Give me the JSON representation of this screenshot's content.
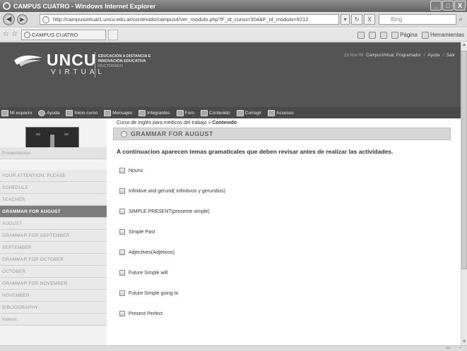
{
  "window": {
    "title": "CAMPUS CUATRO - Windows Internet Explorer",
    "minimize": "_",
    "maximize": "□",
    "close": "X"
  },
  "browser": {
    "back": "◀",
    "forward": "▶",
    "url": "http://campusvirtual1.uncu.edu.ar/contenido/campus4/ver_modulo.php?F_id_curso=304&F_id_modulo=9212",
    "dropdown": "▾",
    "refresh": "↻",
    "stop": "X",
    "search_placeholder": "Bing",
    "search_button": "⌕",
    "tab_title": "CAMPUS CUATRO",
    "cmd": {
      "page": "Página",
      "tools": "Herramientas"
    }
  },
  "site": {
    "logo_text": "UNCU",
    "logo_sub": "VIRTUAL",
    "edu_line1": "EDUCACIÓN A DISTANCIA E",
    "edu_line2": "INNOVACIÓN EDUCATIVA",
    "edu_line3": "RECTORADO",
    "user_date": "23 Nov 09",
    "user_name": "CampusVirtual, Programador",
    "sep": "/",
    "help": "Ayuda",
    "logout": "Salir"
  },
  "nav": {
    "items": [
      {
        "label": "Mi espacio"
      },
      {
        "label": "Ayuda"
      },
      {
        "label": "Inicio curso"
      },
      {
        "label": "Mensajes"
      },
      {
        "label": "Integrantes"
      },
      {
        "label": "Foro"
      },
      {
        "label": "Contenido"
      },
      {
        "label": "Corregir"
      },
      {
        "label": "Accesos"
      }
    ]
  },
  "sidebar": {
    "items": [
      {
        "label": "Presentación"
      },
      {
        "label": "YOUR ATTENTION, PLEASE"
      },
      {
        "label": "SCHEDULE"
      },
      {
        "label": "TEACHER"
      },
      {
        "label": "GRAMMAR FOR AUGUST"
      },
      {
        "label": "AUGUST"
      },
      {
        "label": "GRAMMAR FOR SEPTEMBER"
      },
      {
        "label": "SEPTEMBER"
      },
      {
        "label": "GRAMMAR FOR OCTOBER"
      },
      {
        "label": "OCTOBER"
      },
      {
        "label": "GRAMMAR FOR NOVEMBER"
      },
      {
        "label": "NOVEMBER"
      },
      {
        "label": "BIBLIOGRAPHY"
      },
      {
        "label": "Videos"
      }
    ],
    "active_index": 4
  },
  "content": {
    "breadcrumb_course": "Curso de Inglés para médicos del trabajo",
    "breadcrumb_sep": "»",
    "breadcrumb_current": "Contenido",
    "section_title": "GRAMMAR FOR AUGUST",
    "intro": "A continuacion aparecen temas gramaticales que deben revisar antes de realizar las actividades.",
    "topics": [
      {
        "label": "Nouns"
      },
      {
        "label": "Infinitive and gerund( Infinitivos y gerundios)"
      },
      {
        "label": "SIMPLE PRESENT(presente simple)"
      },
      {
        "label": "Simple Past"
      },
      {
        "label": "Adjectives(Adjetivos)"
      },
      {
        "label": "Future Simple will"
      },
      {
        "label": "Future Simple going to"
      },
      {
        "label": "Present Perfect"
      }
    ]
  },
  "colors": {
    "header_bg": "#545454",
    "nav_bg": "#494949",
    "active_menu": "#7b7b7b",
    "section_bg": "#d6d6d6"
  }
}
